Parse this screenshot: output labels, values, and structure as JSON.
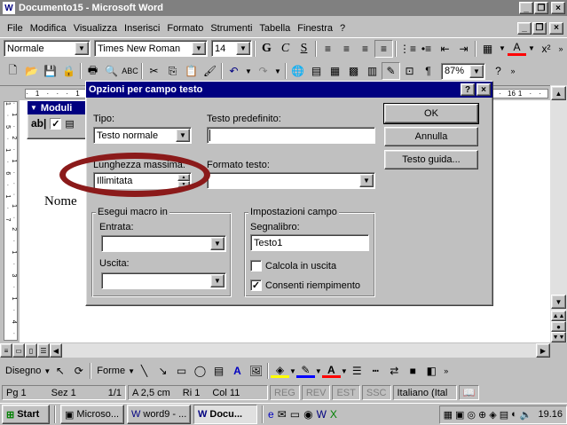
{
  "window": {
    "title": "Documento15 - Microsoft Word"
  },
  "menu": [
    "File",
    "Modifica",
    "Visualizza",
    "Inserisci",
    "Formato",
    "Strumenti",
    "Tabella",
    "Finestra",
    "?"
  ],
  "format_toolbar": {
    "style": "Normale",
    "font": "Times New Roman",
    "size": "14",
    "bold": "G",
    "italic": "C",
    "underline": "S"
  },
  "standard_toolbar": {
    "zoom": "87%"
  },
  "moduli_toolbar": {
    "title": "Moduli",
    "field_icon": "ab|"
  },
  "document": {
    "text": "Nome"
  },
  "ruler": {
    "mark": "16"
  },
  "dialog": {
    "title": "Opzioni per campo testo",
    "help": "?",
    "close": "×",
    "tipo_label": "Tipo:",
    "tipo_value": "Testo normale",
    "predef_label": "Testo predefinito:",
    "predef_value": "",
    "lunghezza_label": "Lunghezza massima:",
    "lunghezza_value": "Illimitata",
    "formato_label": "Formato testo:",
    "formato_value": "",
    "macro_group": "Esegui macro in",
    "entrata_label": "Entrata:",
    "uscita_label": "Uscita:",
    "impostazioni_group": "Impostazioni campo",
    "segnalibro_label": "Segnalibro:",
    "segnalibro_value": "Testo1",
    "calcola_label": "Calcola in uscita",
    "consenti_label": "Consenti riempimento",
    "ok": "OK",
    "annulla": "Annulla",
    "guida": "Testo guida..."
  },
  "drawing_toolbar": {
    "disegno": "Disegno",
    "forme": "Forme"
  },
  "status": {
    "pg": "Pg 1",
    "sez": "Sez 1",
    "pages": "1/1",
    "a": "A 2,5 cm",
    "ri": "Ri 1",
    "col": "Col 11",
    "reg": "REG",
    "rev": "REV",
    "est": "EST",
    "ssc": "SSC",
    "lang": "Italiano (Ital"
  },
  "taskbar": {
    "start": "Start",
    "tasks": [
      "Microso...",
      "word9 - ...",
      "Docu..."
    ],
    "clock": "19.16"
  },
  "colors": {
    "titlebar_active": "#000080",
    "face": "#c0c0c0",
    "highlight_ellipse": "#8b1a1a"
  }
}
